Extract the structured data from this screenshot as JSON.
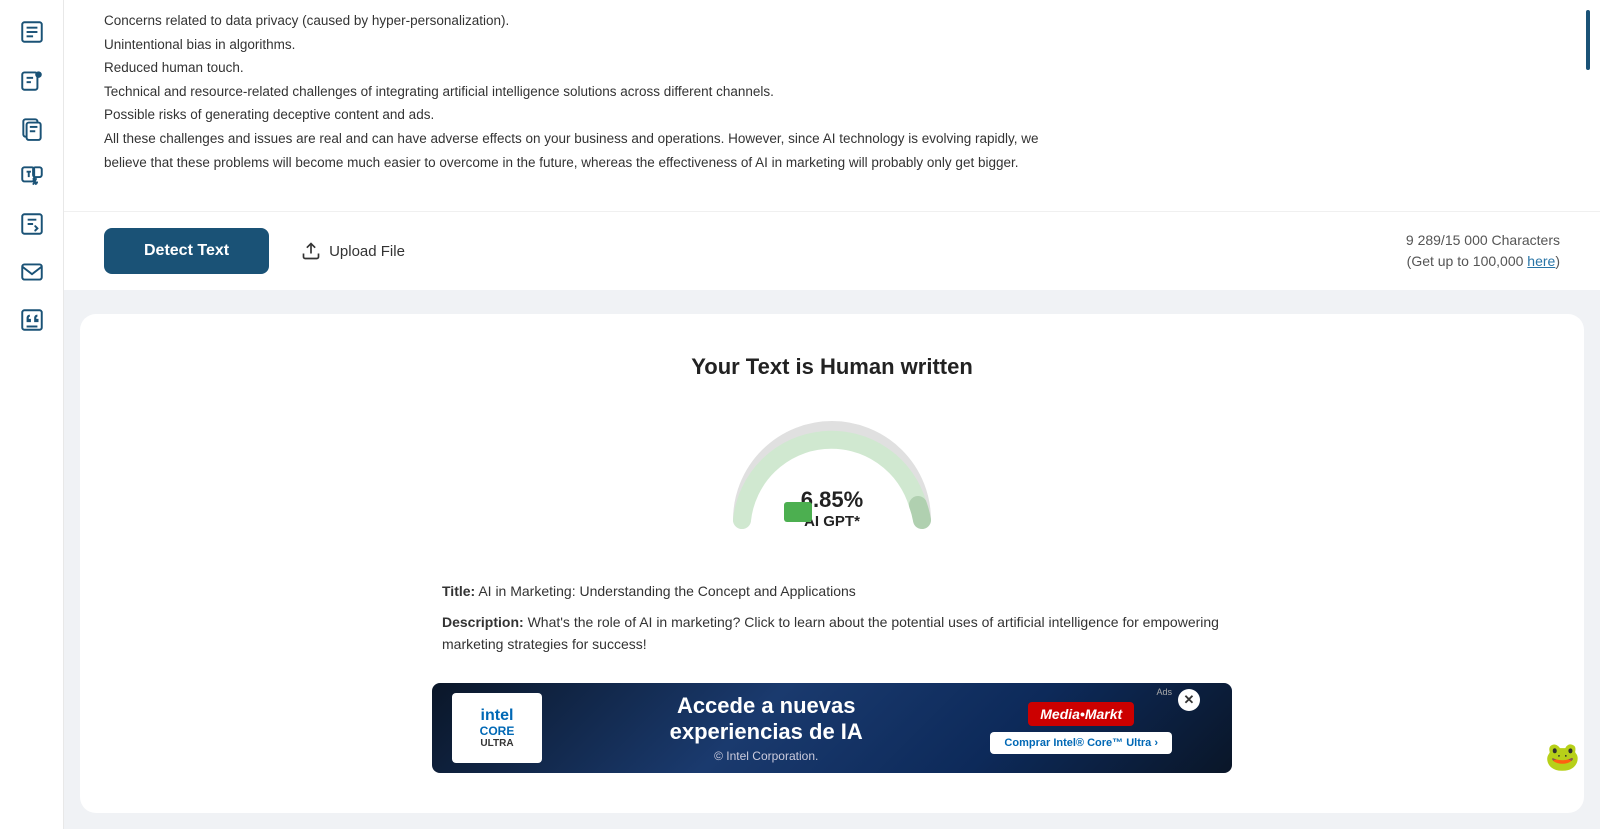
{
  "sidebar": {
    "items": [
      {
        "id": "text-check",
        "icon": "document-lines"
      },
      {
        "id": "ai-check",
        "icon": "robot-document"
      },
      {
        "id": "copy-check",
        "icon": "copy-lines"
      },
      {
        "id": "translate",
        "icon": "translate"
      },
      {
        "id": "rewrite",
        "icon": "rewrite"
      },
      {
        "id": "email",
        "icon": "email"
      },
      {
        "id": "quote",
        "icon": "quote-lines"
      }
    ]
  },
  "input": {
    "text_lines": [
      "Concerns related to data privacy (caused by hyper-personalization).",
      "Unintentional bias in algorithms.",
      "Reduced human touch.",
      "Technical and resource-related challenges of integrating artificial intelligence solutions across different channels.",
      "Possible risks of generating deceptive content and ads.",
      "All these challenges and issues are real and can have adverse effects on your business and operations. However, since AI technology is evolving rapidly, we",
      "believe that these problems will become much easier to overcome in the future, whereas the effectiveness of AI in marketing will probably only get bigger."
    ],
    "detect_button": "Detect Text",
    "upload_button": "Upload File",
    "char_count": "9 289/15 000 Characters",
    "char_upgrade": "(Get up to 100,000 ",
    "here_link": "here",
    "char_upgrade_end": ")"
  },
  "result": {
    "title": "Your Text is Human written",
    "percent": "6.85%",
    "label": "AI GPT*",
    "gauge_human_pct": 93.15,
    "gauge_ai_pct": 6.85
  },
  "metadata": {
    "title_label": "Title:",
    "title_value": "AI in Marketing: Understanding the Concept and Applications",
    "desc_label": "Description:",
    "desc_value": "What's the role of AI in marketing? Click to learn about the potential uses of artificial intelligence for empowering marketing strategies for success!"
  },
  "ad": {
    "brand": "intel",
    "core": "CORE",
    "ultra": "ULTRA",
    "main_text": "Accede a nuevas",
    "main_text2": "experiencias de IA",
    "sub_text": "© Intel Corporation.",
    "retailer": "Media•Markt",
    "cta": "Comprar Intel® Core™ Ultra ›",
    "close_label": "✕",
    "ad_label": "Ads"
  }
}
